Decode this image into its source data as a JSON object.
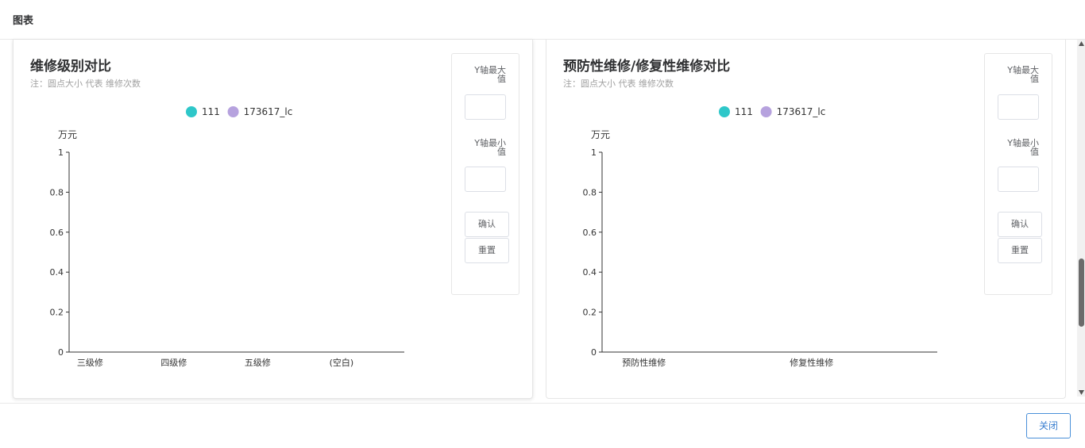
{
  "header": {
    "title": "图表"
  },
  "panels": [
    {
      "title": "维修级别对比",
      "subtitle": "注：圆点大小 代表 维修次数",
      "legend": [
        {
          "label": "111",
          "color": "#2ec7c9"
        },
        {
          "label": "173617_lc",
          "color": "#b6a2de"
        }
      ],
      "controls": {
        "ymax_label": "Y轴最大值",
        "ymin_label": "Y轴最小值",
        "ymax_value": "",
        "ymin_value": "",
        "confirm_label": "确认",
        "reset_label": "重置"
      }
    },
    {
      "title": "预防性维修/修复性维修对比",
      "subtitle": "注：圆点大小 代表 维修次数",
      "legend": [
        {
          "label": "111",
          "color": "#2ec7c9"
        },
        {
          "label": "173617_lc",
          "color": "#b6a2de"
        }
      ],
      "controls": {
        "ymax_label": "Y轴最大值",
        "ymin_label": "Y轴最小值",
        "ymax_value": "",
        "ymin_value": "",
        "confirm_label": "确认",
        "reset_label": "重置"
      }
    }
  ],
  "chart_data": [
    {
      "type": "scatter",
      "ylabel": "万元",
      "categories": [
        "三级修",
        "四级修",
        "五级修",
        "(空白)"
      ],
      "yticks": [
        "0",
        "0.2",
        "0.4",
        "0.6",
        "0.8",
        "1"
      ],
      "ylim": [
        0,
        1
      ],
      "series": [
        {
          "name": "111",
          "values": []
        },
        {
          "name": "173617_lc",
          "values": []
        }
      ],
      "legend_position": "top-center",
      "grid": false
    },
    {
      "type": "scatter",
      "ylabel": "万元",
      "categories": [
        "预防性维修",
        "修复性维修"
      ],
      "yticks": [
        "0",
        "0.2",
        "0.4",
        "0.6",
        "0.8",
        "1"
      ],
      "ylim": [
        0,
        1
      ],
      "series": [
        {
          "name": "111",
          "values": []
        },
        {
          "name": "173617_lc",
          "values": []
        }
      ],
      "legend_position": "top-center",
      "grid": false
    }
  ],
  "footer": {
    "close_label": "关闭"
  }
}
